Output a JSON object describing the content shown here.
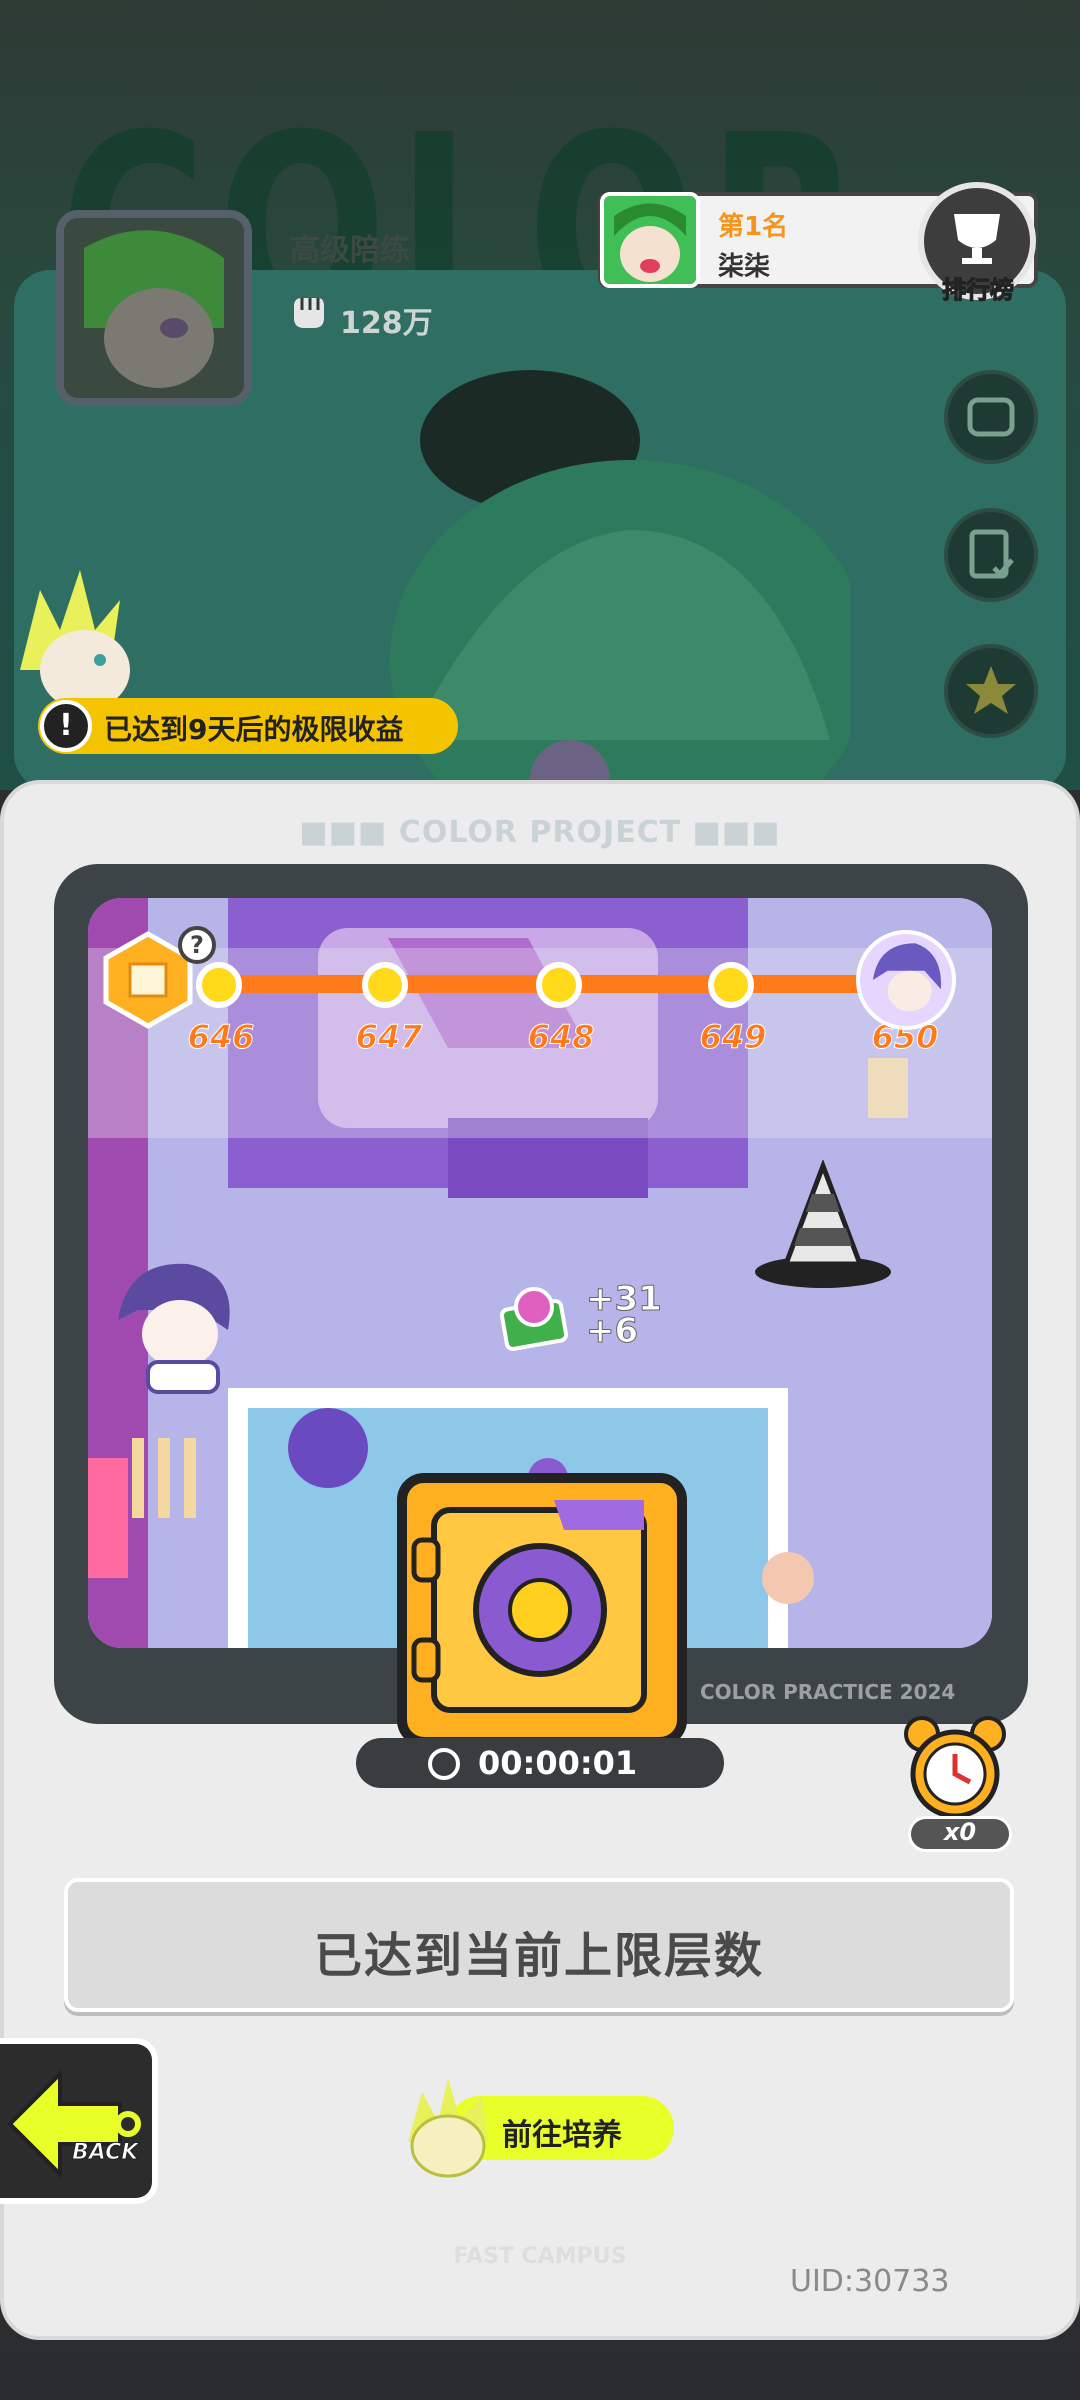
{
  "profile": {
    "name": "高级陪练",
    "power": "128万"
  },
  "rank": {
    "position": "第1名",
    "player": "柒柒",
    "button_label": "排行榜"
  },
  "notice": {
    "text": "已达到9天后的极限收益"
  },
  "dialog": {
    "title": "COLOR PROJECT",
    "credit": "COLOR PRACTICE 2024"
  },
  "progress": {
    "levels": [
      "646",
      "647",
      "648",
      "649",
      "650"
    ],
    "help_badge": "?"
  },
  "reward": {
    "line1": "+31",
    "line2": "+6"
  },
  "safe": {
    "timer": "00:00:01"
  },
  "alarm": {
    "count": "x0"
  },
  "status": {
    "max_text": "已达到当前上限层数"
  },
  "back": {
    "label": "BACK"
  },
  "train": {
    "label": "前往培养"
  },
  "footer": {
    "campus": "FAST CAMPUS",
    "uid": "UID:30733"
  },
  "colors": {
    "accent_orange": "#ff7a1a",
    "accent_yellow": "#e8ff2a",
    "stage": "#b7b4ea"
  }
}
